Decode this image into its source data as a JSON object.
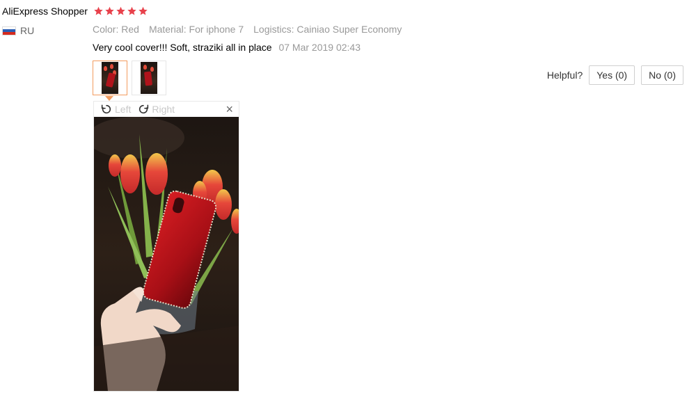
{
  "reviewer": {
    "name": "AliExpress Shopper",
    "country": "RU",
    "rating": 5
  },
  "attributes": [
    {
      "key": "Color:",
      "value": "Red"
    },
    {
      "key": "Material:",
      "value": "For iphone 7"
    },
    {
      "key": "Logistics:",
      "value": "Cainiao Super Economy"
    }
  ],
  "review": {
    "text": "Very cool cover!!! Soft, straziki all in place",
    "date": "07 Mar 2019 02:43"
  },
  "helpful": {
    "label": "Helpful?",
    "yes_label": "Yes (0)",
    "no_label": "No (0)"
  },
  "viewer": {
    "rotate_left_label": "Left",
    "rotate_right_label": "Right",
    "close_label": "×"
  },
  "colors": {
    "star": "#e8424c",
    "thumb_active_border": "#f39c5f",
    "muted_text": "#999999",
    "flag_white": "#ffffff",
    "flag_blue": "#2b5fb5",
    "flag_red": "#d52b1e"
  },
  "icons": {
    "star": "star-icon",
    "flag": "flag-ru-icon",
    "rotate_left": "rotate-left-icon",
    "rotate_right": "rotate-right-icon",
    "close": "close-icon"
  }
}
